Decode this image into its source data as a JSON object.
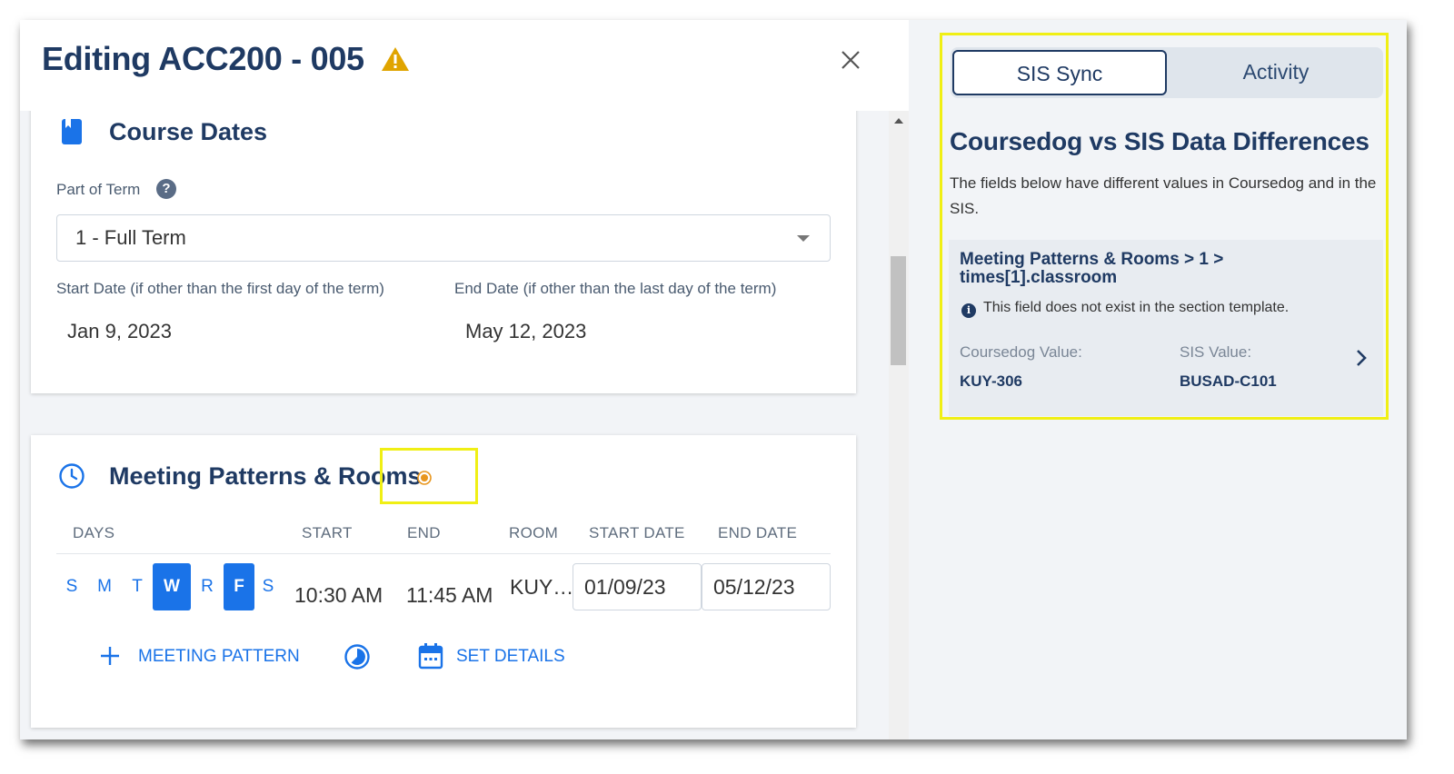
{
  "editor": {
    "title": "Editing ACC200 - 005",
    "warning_icon": "warning-triangle-icon",
    "close_icon": "close-icon"
  },
  "course_dates": {
    "title": "Course Dates",
    "icon": "book-icon",
    "part_of_term_label": "Part of Term",
    "help_icon": "help-icon",
    "help_glyph": "?",
    "part_of_term_value": "1 - Full Term",
    "start_date_label": "Start Date (if other than the first day of the term)",
    "start_date_value": "Jan 9, 2023",
    "end_date_label": "End Date (if other than the last day of the term)",
    "end_date_value": "May 12, 2023"
  },
  "meeting_patterns": {
    "title": "Meeting Patterns & Rooms",
    "icon": "clock-icon",
    "changed_indicator": "change-dot-icon",
    "columns": [
      "DAYS",
      "START",
      "END",
      "ROOM",
      "START DATE",
      "END DATE"
    ],
    "days": [
      {
        "label": "S",
        "selected": false
      },
      {
        "label": "M",
        "selected": false
      },
      {
        "label": "T",
        "selected": false
      },
      {
        "label": "W",
        "selected": true
      },
      {
        "label": "R",
        "selected": false
      },
      {
        "label": "F",
        "selected": true
      },
      {
        "label": "S",
        "selected": false
      }
    ],
    "start_time": "10:30 AM",
    "end_time": "11:45 AM",
    "room": "KUY…",
    "start_date": "01/09/23",
    "end_date": "05/12/23",
    "add_meeting_pattern_label": "MEETING PATTERN",
    "set_details_label": "SET DETAILS"
  },
  "right_panel": {
    "tabs": [
      {
        "label": "SIS Sync",
        "active": true
      },
      {
        "label": "Activity",
        "active": false
      }
    ],
    "title": "Coursedog vs SIS Data Differences",
    "description": "The fields below have different values in Coursedog and in the SIS.",
    "difference": {
      "path_line1": "Meeting Patterns & Rooms > 1 >",
      "path_line2": "times[1].classroom",
      "info_glyph": "i",
      "info_text": "This field does not exist in the section template.",
      "coursedog_label": "Coursedog Value:",
      "coursedog_value": "KUY-306",
      "sis_label": "SIS Value:",
      "sis_value": "BUSAD-C101"
    }
  },
  "colors": {
    "primary_blue": "#1a73e8",
    "navy": "#1f3a63",
    "warning": "#e0a400",
    "highlight": "#f0ef14"
  }
}
